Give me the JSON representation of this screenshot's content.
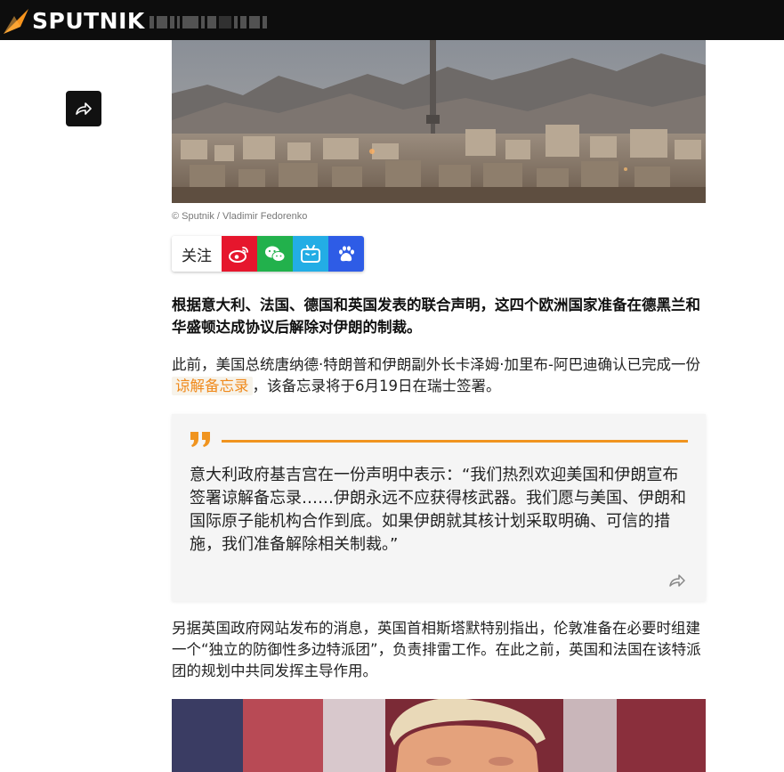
{
  "header": {
    "logo_text": "SPUTNIK",
    "logo_color": "#f7941d",
    "background": "#0d0d0d"
  },
  "share_button": {
    "icon": "share-icon"
  },
  "hero": {
    "alt": "德黑兰城市风景",
    "caption": "© Sputnik / Vladimir Fedorenko"
  },
  "follow": {
    "label": "关注",
    "icons": [
      {
        "name": "weibo-icon",
        "color": "#e6162d"
      },
      {
        "name": "wechat-icon",
        "color": "#22b14c"
      },
      {
        "name": "bilibili-icon",
        "color": "#23ade5"
      },
      {
        "name": "baidu-icon",
        "color": "#2e5ce6"
      }
    ]
  },
  "article": {
    "lead": "根据意大利、法国、德国和英国发表的联合声明，这四个欧洲国家准备在德黑兰和华盛顿达成协议后解除对伊朗的制裁。",
    "para1_before": "此前，美国总统唐纳德·特朗普和伊朗副外长卡泽姆·加里布-阿巴迪确认已完成一份",
    "para1_link": "谅解备忘录",
    "para1_after": "，该备忘录将于6月19日在瑞士签署。",
    "quote": "意大利政府基吉宫在一份声明中表示：“我们热烈欢迎美国和伊朗宣布签署谅解备忘录……伊朗永远不应获得核武器。我们愿与美国、伊朗和国际原子能机构合作到底。如果伊朗就其核计划采取明确、可信的措施，我们准备解除相关制裁。”",
    "para2": "另据英国政府网站发布的消息，英国首相斯塔默特别指出，伦敦准备在必要时组建一个“独立的防御性多边特派团”，负责排雷工作。在此之前，英国和法国在该特派团的规划中共同发挥主导作用。"
  },
  "accent_color": "#f0941f"
}
